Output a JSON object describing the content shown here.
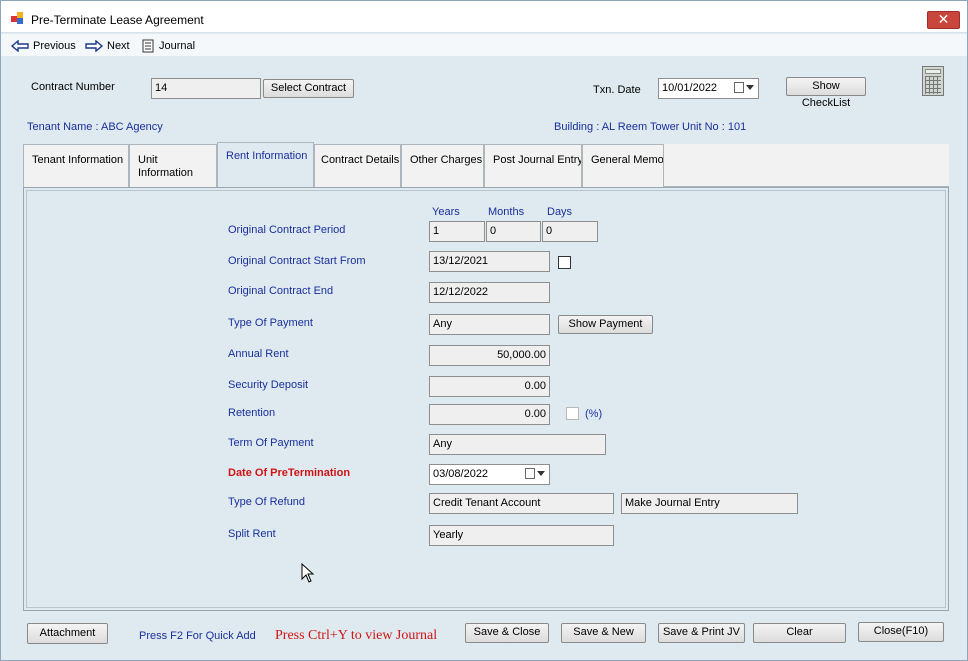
{
  "window": {
    "title": "Pre-Terminate Lease Agreement",
    "close_glyph": "✕"
  },
  "navbar": {
    "previous": "Previous",
    "next": "Next",
    "journal": "Journal"
  },
  "header": {
    "contract_number_label": "Contract Number",
    "contract_number_value": "14",
    "select_contract": "Select Contract",
    "txn_date_label": "Txn. Date",
    "txn_date_value": "10/01/2022",
    "show_checklist": "Show CheckList",
    "tenant_name": "Tenant Name : ABC Agency",
    "building": "Building : AL Reem Tower",
    "unit_no": "Unit No : 101"
  },
  "tabs": [
    {
      "label": "Tenant Information"
    },
    {
      "label": "Unit\nInformation"
    },
    {
      "label": "Rent Information"
    },
    {
      "label": "Contract Details"
    },
    {
      "label": "Other Charges"
    },
    {
      "label": "Post Journal Entry"
    },
    {
      "label": "General Memo"
    }
  ],
  "rent": {
    "col_years": "Years",
    "col_months": "Months",
    "col_days": "Days",
    "period_label": "Original Contract Period",
    "period_years": "1",
    "period_months": "0",
    "period_days": "0",
    "start_label": "Original Contract Start From",
    "start_value": "13/12/2021",
    "end_label": "Original Contract End",
    "end_value": "12/12/2022",
    "type_payment_label": "Type Of Payment",
    "type_payment_value": "Any",
    "show_payment": "Show Payment",
    "annual_rent_label": "Annual Rent",
    "annual_rent_value": "50,000.00",
    "security_label": "Security Deposit",
    "security_value": "0.00",
    "retention_label": "Retention",
    "retention_value": "0.00",
    "retention_pct": "(%)",
    "term_label": "Term Of Payment",
    "term_value": "Any",
    "pretermination_label": "Date Of PreTermination",
    "pretermination_value": "03/08/2022",
    "refund_label": "Type Of Refund",
    "refund_value": "Credit Tenant Account",
    "journal_entry_value": "Make Journal Entry",
    "split_label": "Split Rent",
    "split_value": "Yearly"
  },
  "footer": {
    "attachment": "Attachment",
    "f2_hint": "Press F2 For Quick Add",
    "ctrl_y_hint": "Press Ctrl+Y to view Journal",
    "save_close": "Save & Close",
    "save_new": "Save & New",
    "save_print": "Save & Print JV",
    "clear": "Clear",
    "close": "Close(F10)"
  },
  "colors": {
    "label_blue": "#1a2f9c",
    "alert_red": "#d01414",
    "close_red": "#c9463d"
  }
}
